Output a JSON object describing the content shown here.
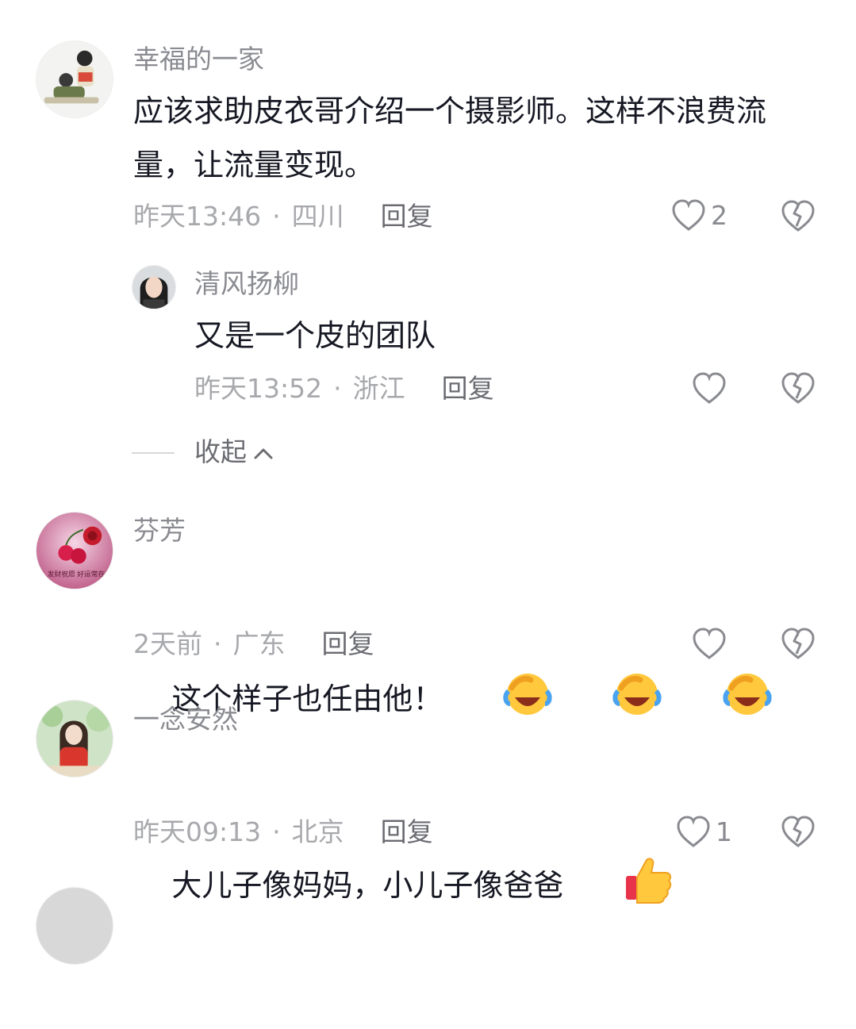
{
  "comments": [
    {
      "username": "幸福的一家",
      "text": "应该求助皮衣哥介绍一个摄影师。这样不浪费流\n量，让流量变现。",
      "time": "昨天13:46",
      "location": "四川",
      "reply_label": "回复",
      "likes": "2"
    },
    {
      "username": "清风扬柳",
      "text": "又是一个皮的团队",
      "time": "昨天13:52",
      "location": "浙江",
      "reply_label": "回复",
      "likes": ""
    },
    {
      "username": "芬芳",
      "text": "这个样子也任由他！",
      "time": "2天前",
      "location": "广东",
      "reply_label": "回复",
      "likes": ""
    },
    {
      "username": "一念安然",
      "text": "大儿子像妈妈，小儿子像爸爸",
      "time": "昨天09:13",
      "location": "北京",
      "reply_label": "回复",
      "likes": "1"
    }
  ],
  "separator_dot": "·",
  "collapse_label": "收起",
  "avatar_text_fenfang": "发财祝愿 好运常在",
  "icons": {
    "like": "heart-outline-icon",
    "dislike": "broken-heart-icon",
    "collapse": "chevron-up-icon",
    "emoji_laugh": "laughing-crying-emoji",
    "emoji_thumb": "thumbs-up-emoji"
  },
  "colors": {
    "primary_text": "#161823",
    "secondary_text": "#8a8b91",
    "meta_text": "#a8a9ad"
  }
}
